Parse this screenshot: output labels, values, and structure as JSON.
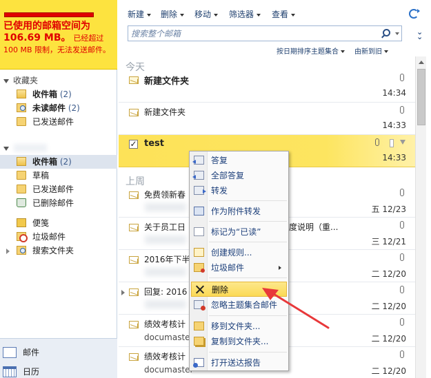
{
  "quota": {
    "line1": "已使用的邮箱空间为",
    "size": "106.69 MB",
    "sep": "。",
    "line2a": "已经超过",
    "line3": "100 MB 限制，无法发送邮件。"
  },
  "favorites": {
    "header": "收藏夹",
    "items": [
      {
        "label": "收件箱",
        "count": "(2)",
        "bold": true
      },
      {
        "label": "未读邮件",
        "count": "(2)",
        "bold": true
      },
      {
        "label": "已发送邮件",
        "count": "",
        "bold": false
      }
    ]
  },
  "mailbox": {
    "items": [
      {
        "label": "收件箱",
        "count": "(2)"
      },
      {
        "label": "草稿",
        "count": ""
      },
      {
        "label": "已发送邮件",
        "count": ""
      },
      {
        "label": "已删除邮件",
        "count": ""
      },
      {
        "label": "便笺",
        "count": ""
      },
      {
        "label": "垃圾邮件",
        "count": ""
      },
      {
        "label": "搜索文件夹",
        "count": ""
      }
    ]
  },
  "bottom_nav": {
    "grip": "•••••",
    "mail": "邮件",
    "calendar": "日历"
  },
  "toolbar": {
    "new": "新建",
    "delete": "删除",
    "move": "移动",
    "filter": "筛选器",
    "view": "查看",
    "search_placeholder": "搜索整个邮箱",
    "sort_by": "按日期排序主题集合",
    "sort_order": "由新到旧"
  },
  "groups": {
    "today": "今天",
    "last_week": "上周"
  },
  "mails": [
    {
      "subject": "新建文件夹",
      "sender": "",
      "time": "14:34"
    },
    {
      "subject": "新建文件夹",
      "sender": "",
      "time": "14:33"
    },
    {
      "subject": "test",
      "sender": "",
      "time": "14:33"
    },
    {
      "subject": "免费领新春",
      "sender": "",
      "time": "五 12/23"
    },
    {
      "subject": "关于员工日",
      "subject_tail": "度说明（重...",
      "sender": "",
      "time": "三 12/21"
    },
    {
      "subject": "2016年下半",
      "sender": "",
      "time": "二 12/20"
    },
    {
      "subject": "回复: 2016",
      "sender": "",
      "time": "二 12/20"
    },
    {
      "subject": "绩效考核计",
      "sender": "documaster",
      "time": "二 12/20"
    },
    {
      "subject": "绩效考核计",
      "sender": "documaster",
      "time": "二 12/20"
    }
  ],
  "context_menu": {
    "items": [
      "答复",
      "全部答复",
      "转发",
      "作为附件转发",
      "标记为“已读”",
      "创建规则...",
      "垃圾邮件",
      "删除",
      "忽略主题集合邮件",
      "移到文件夹...",
      "复制到文件夹...",
      "打开送达报告"
    ],
    "highlighted_index": 7
  },
  "colors": {
    "quota_bg": "#fde33f",
    "quota_text": "#e00000",
    "selected_mail": "#fde258",
    "accent_arrow": "#e8383a"
  }
}
